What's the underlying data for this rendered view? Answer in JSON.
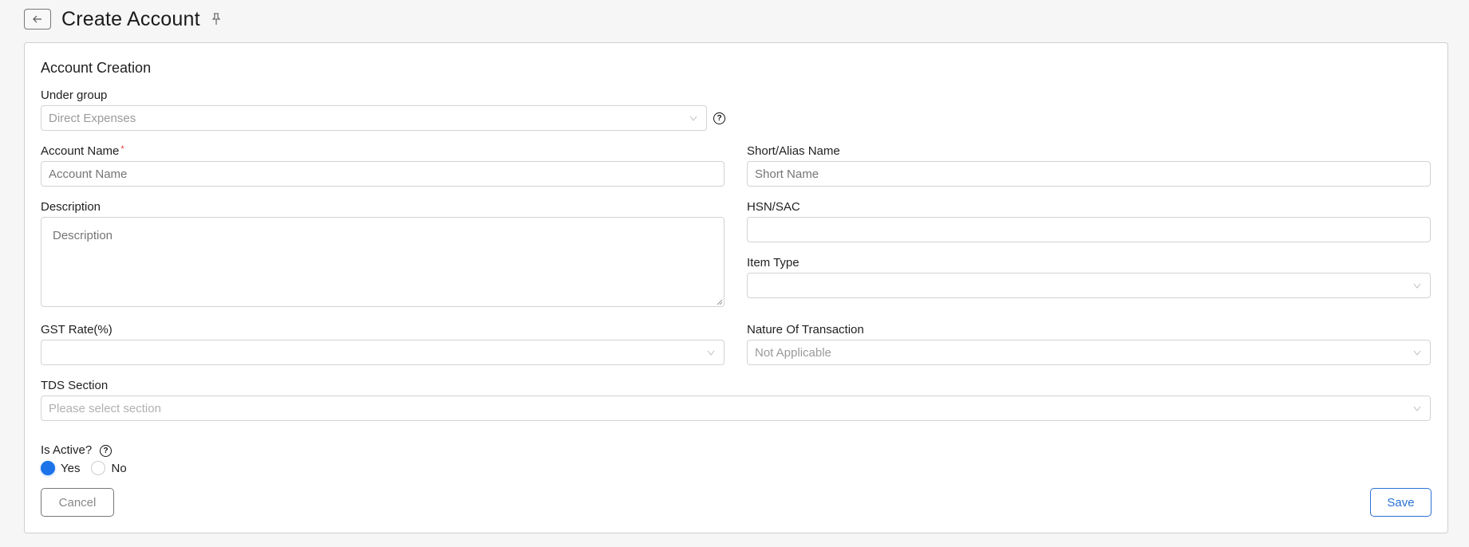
{
  "header": {
    "title": "Create Account",
    "back_icon": "arrow-left-icon",
    "pin_icon": "pin-icon"
  },
  "form": {
    "section_title": "Account Creation",
    "under_group": {
      "label": "Under group",
      "value": "Direct Expenses"
    },
    "account_name": {
      "label": "Account Name",
      "required_mark": "*",
      "placeholder": "Account Name",
      "value": ""
    },
    "short_name": {
      "label": "Short/Alias Name",
      "placeholder": "Short Name",
      "value": ""
    },
    "description": {
      "label": "Description",
      "placeholder": "Description",
      "value": ""
    },
    "hsn_sac": {
      "label": "HSN/SAC",
      "value": ""
    },
    "item_type": {
      "label": "Item Type",
      "value": ""
    },
    "gst_rate": {
      "label": "GST Rate(%)",
      "value": ""
    },
    "nature_of_transaction": {
      "label": "Nature Of Transaction",
      "value": "Not Applicable"
    },
    "tds_section": {
      "label": "TDS Section",
      "placeholder": "Please select section",
      "value": ""
    },
    "is_active": {
      "label": "Is Active?",
      "options": [
        {
          "label": "Yes",
          "checked": true
        },
        {
          "label": "No",
          "checked": false
        }
      ]
    },
    "help_glyph": "?"
  },
  "actions": {
    "cancel_label": "Cancel",
    "save_label": "Save"
  },
  "colors": {
    "accent": "#1a73e8",
    "save_border": "#2a72d4",
    "required": "#e53935"
  }
}
